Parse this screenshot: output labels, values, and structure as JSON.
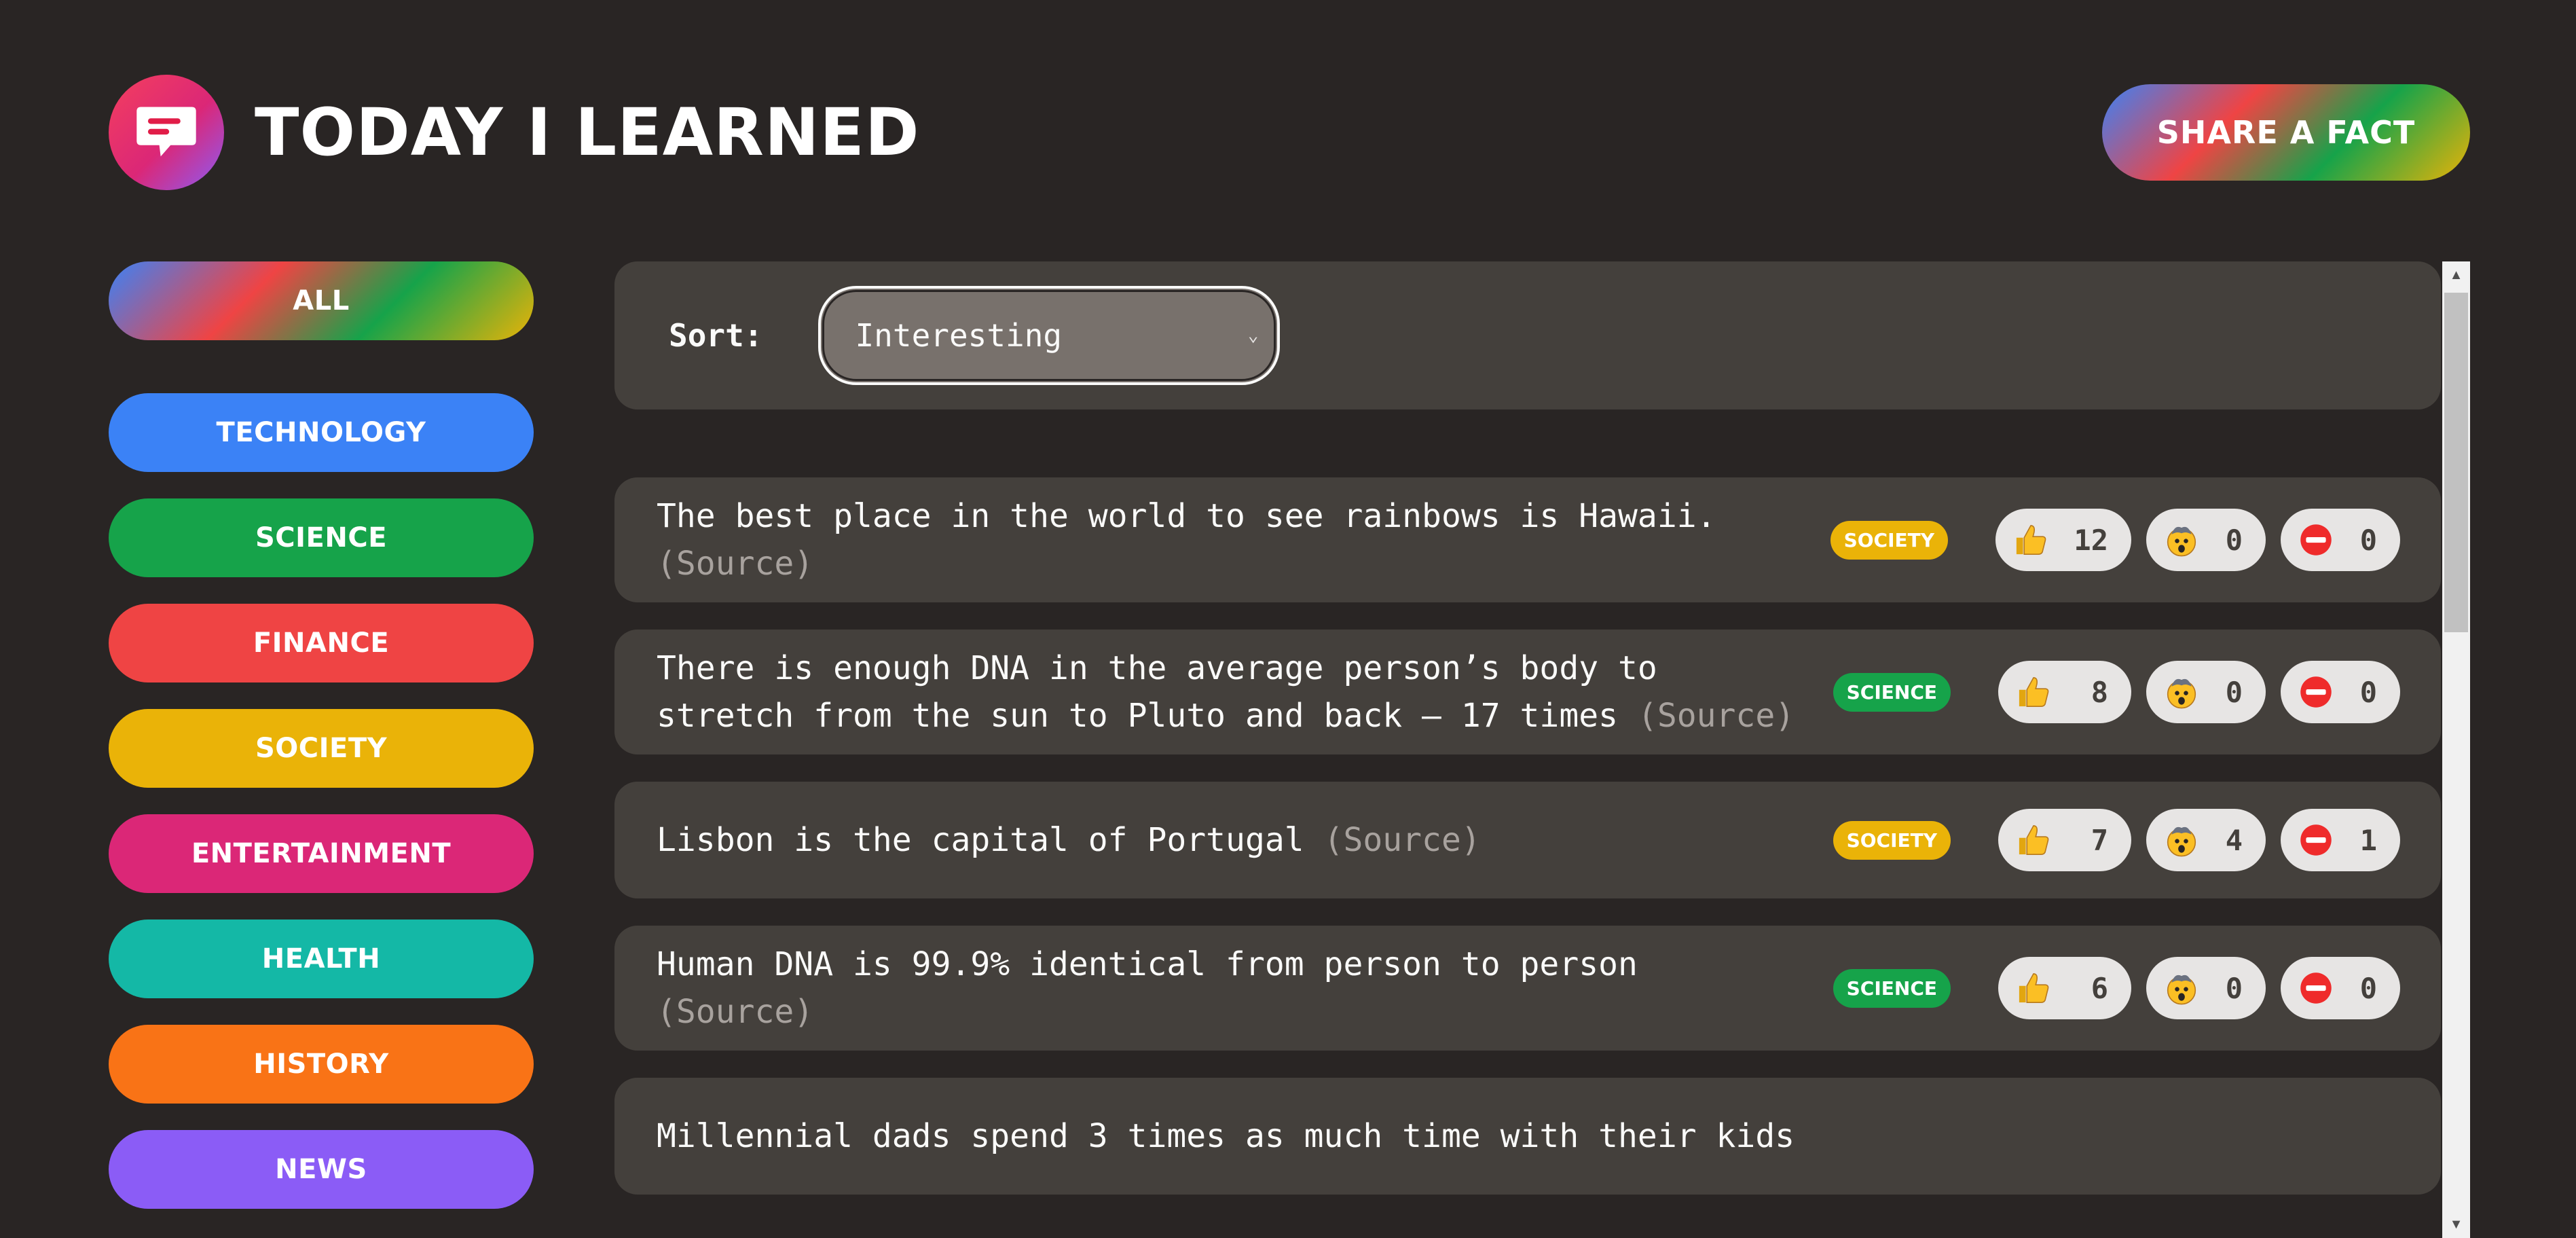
{
  "header": {
    "title": "Today I Learned",
    "share_label": "Share a fact"
  },
  "sidebar": {
    "all_label": "All",
    "categories": [
      {
        "label": "Technology",
        "color": "#3b82f6"
      },
      {
        "label": "Science",
        "color": "#16a34a"
      },
      {
        "label": "Finance",
        "color": "#ef4444"
      },
      {
        "label": "Society",
        "color": "#eab308"
      },
      {
        "label": "Entertainment",
        "color": "#db2777"
      },
      {
        "label": "Health",
        "color": "#14b8a6"
      },
      {
        "label": "History",
        "color": "#f97316"
      },
      {
        "label": "News",
        "color": "#8b5cf6"
      }
    ]
  },
  "sort": {
    "label": "Sort:",
    "selected": "Interesting"
  },
  "facts": [
    {
      "text": "The best place in the world to see rainbows is Hawaii.",
      "source_label": "(Source)",
      "category": "Society",
      "category_color": "#eab308",
      "interesting": "12",
      "mindblowing": "0",
      "false": "0"
    },
    {
      "text": "There is enough DNA in the average person’s body to stretch from the sun to Pluto and back — 17 times",
      "source_label": "(Source)",
      "category": "Science",
      "category_color": "#16a34a",
      "interesting": "8",
      "mindblowing": "0",
      "false": "0"
    },
    {
      "text": "Lisbon is the capital of Portugal",
      "source_label": "(Source)",
      "category": "Society",
      "category_color": "#eab308",
      "interesting": "7",
      "mindblowing": "4",
      "false": "1"
    },
    {
      "text": "Human DNA is 99.9% identical from person to person",
      "source_label": "(Source)",
      "category": "Science",
      "category_color": "#16a34a",
      "interesting": "6",
      "mindblowing": "0",
      "false": "0"
    },
    {
      "text": "Millennial dads spend 3 times as much time with their kids",
      "source_label": "",
      "category": "",
      "category_color": "#44403c",
      "interesting": "",
      "mindblowing": "",
      "false": ""
    }
  ],
  "icons": {
    "logo": "speech-bubble-icon",
    "interesting": "thumbs-up-icon",
    "mindblowing": "mind-blown-emoji-icon",
    "false": "no-entry-icon"
  }
}
